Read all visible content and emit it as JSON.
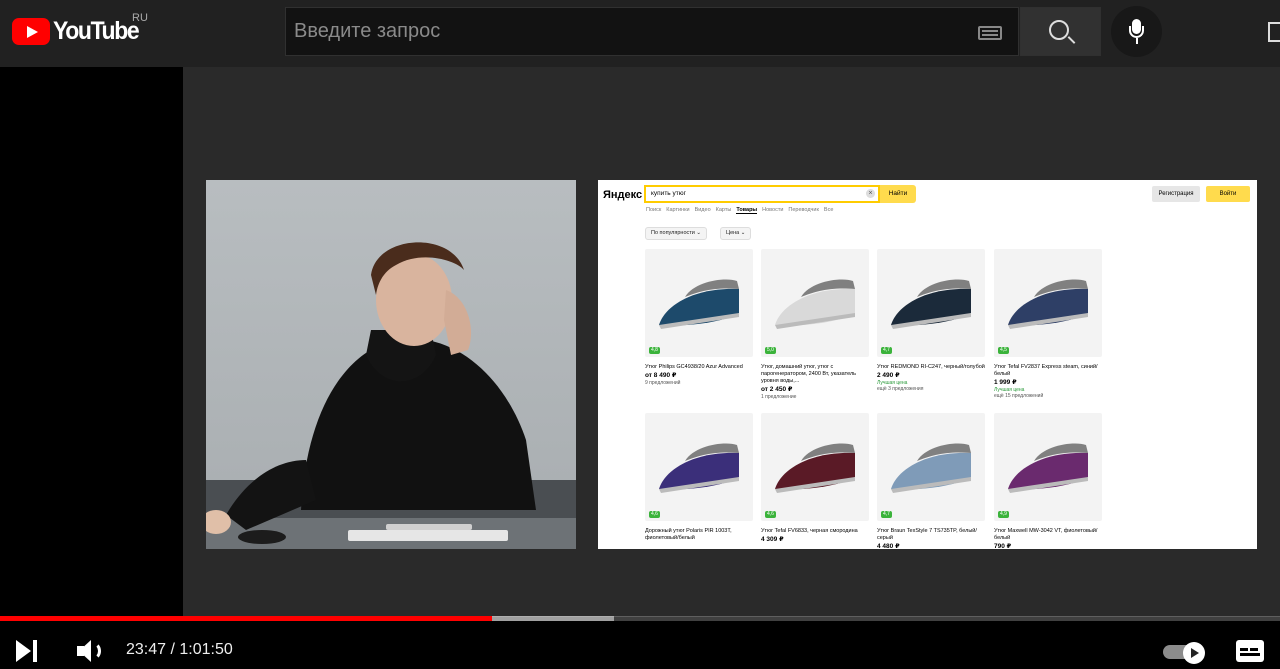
{
  "header": {
    "logo_text": "YouTube",
    "region": "RU",
    "search_placeholder": "Введите запрос"
  },
  "player": {
    "current_time": "23:47",
    "duration": "1:01:50",
    "time_display": "23:47 / 1:01:50",
    "played_fraction": 0.3846,
    "buffered_fraction": 0.48,
    "autoplay_on": true,
    "colors": {
      "played": "#ff0000",
      "bar_bg": "#212121"
    }
  },
  "video_content": {
    "yandex": {
      "logo": "Яндекс",
      "query": "купить утюг",
      "find_button": "Найти",
      "register_button": "Регистрация",
      "login_button": "Войти",
      "tabs": [
        "Поиск",
        "Картинки",
        "Видео",
        "Карты",
        "Товары",
        "Новости",
        "Переводчик",
        "Все"
      ],
      "active_tab": "Товары",
      "filters": [
        "По популярности",
        "Цена"
      ],
      "products": [
        {
          "title": "Утюг Philips GC4938/20 Azur Advanced",
          "price": "от 8 490 ₽",
          "note": "",
          "offers": "9 предложений",
          "rating": "4,8",
          "color": "#1d4a6b"
        },
        {
          "title": "Утюг, домашний утюг, утюг с парогенератором, 2400 Вт, указатель уровня воды,...",
          "price": "от 2 450 ₽",
          "note": "",
          "offers": "1 предложение",
          "rating": "5,0",
          "color": "#d9d9d9"
        },
        {
          "title": "Утюг REDMOND RI-C247, черный/голубой",
          "price": "2 490 ₽",
          "note": "Лучшая цена",
          "offers": "ещё 3 предложения",
          "rating": "4,7",
          "color": "#1b2a3a"
        },
        {
          "title": "Утюг Tefal FV2837 Express steam, синий/белый",
          "price": "1 999 ₽",
          "note": "Лучшая цена",
          "offers": "ещё 15 предложений",
          "rating": "4,5",
          "color": "#2e3f66"
        },
        {
          "title": "Дорожный утюг Polaris PIR 1003T, фиолетовый/белый",
          "price": "",
          "note": "",
          "offers": "",
          "rating": "4,6",
          "color": "#3b2f7a"
        },
        {
          "title": "Утюг Tefal FV6833, черная смородина",
          "price": "4 309 ₽",
          "note": "",
          "offers": "",
          "rating": "4,6",
          "color": "#5a1a26"
        },
        {
          "title": "Утюг Braun TexStyle 7 TS735TP, белый/серый",
          "price": "4 480 ₽",
          "note": "",
          "offers": "",
          "rating": "4,7",
          "color": "#7f9bb8"
        },
        {
          "title": "Утюг Maxwell MW-3042 VT, фиолетовый/белый",
          "price": "790 ₽",
          "note": "",
          "offers": "",
          "rating": "4,9",
          "color": "#6a2a6e"
        }
      ]
    }
  }
}
